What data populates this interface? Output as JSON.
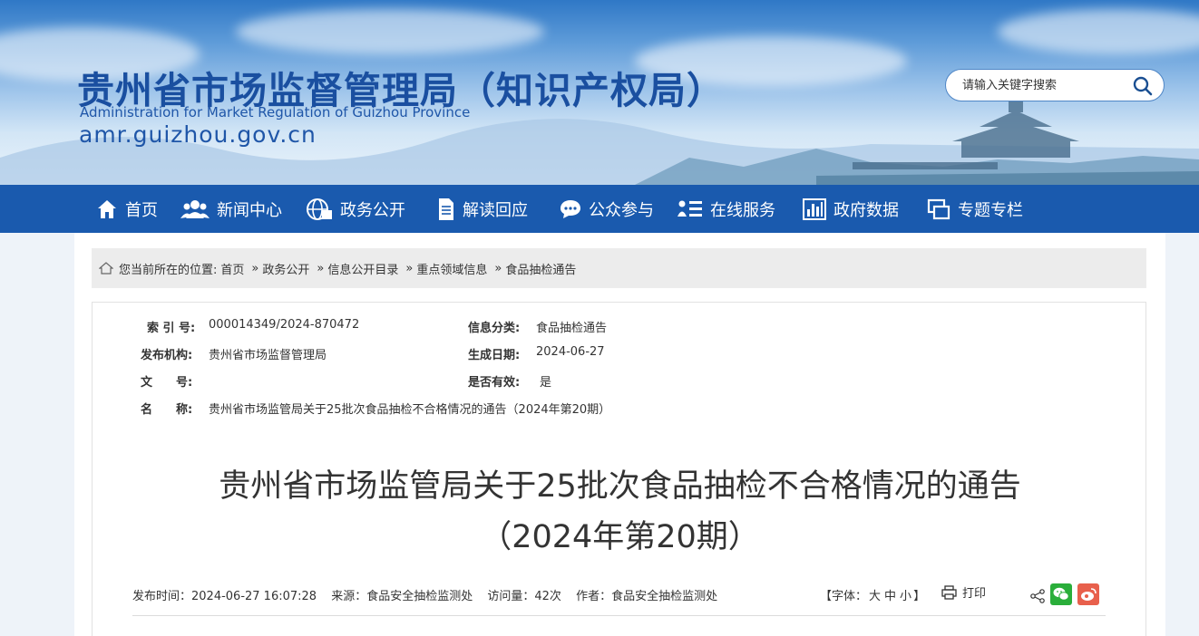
{
  "header": {
    "title": "贵州省市场监督管理局（知识产权局）",
    "subtitle_en": "Administration for Market Regulation of Guizhou Province",
    "url": "amr.guizhou.gov.cn",
    "search_placeholder": "请输入关键字搜索",
    "search_icon": "search-icon"
  },
  "nav": {
    "items": [
      {
        "label": "首页",
        "icon": "home-icon"
      },
      {
        "label": "新闻中心",
        "icon": "users-icon"
      },
      {
        "label": "政务公开",
        "icon": "globe-icon"
      },
      {
        "label": "解读回应",
        "icon": "document-icon"
      },
      {
        "label": "公众参与",
        "icon": "chat-icon"
      },
      {
        "label": "在线服务",
        "icon": "list-icon"
      },
      {
        "label": "政府数据",
        "icon": "bar-chart-icon"
      },
      {
        "label": "专题专栏",
        "icon": "windows-icon"
      }
    ]
  },
  "breadcrumb": {
    "prefix": "您当前所在的位置:",
    "items": [
      "首页",
      "政务公开",
      "信息公开目录",
      "重点领域信息",
      "食品抽检通告"
    ],
    "separator": "»"
  },
  "meta": {
    "index_label": "索 引 号:",
    "index_value": "000014349/2024-870472",
    "category_label": "信息分类:",
    "category_value": "食品抽检通告",
    "publisher_label": "发布机构:",
    "publisher_value": "贵州省市场监督管理局",
    "date_label": "生成日期:",
    "date_value": "2024-06-27",
    "docno_label": "文　　号:",
    "docno_value": "",
    "valid_label": "是否有效:",
    "valid_value": "是",
    "name_label": "名　　称:",
    "name_value": "贵州省市场监管局关于25批次食品抽检不合格情况的通告（2024年第20期）"
  },
  "article": {
    "title_line1": "贵州省市场监管局关于25批次食品抽检不合格情况的通告",
    "title_line2": "（2024年第20期）",
    "publish_time": "发布时间：2024-06-27 16:07:28",
    "source": "来源：食品安全抽检监测处",
    "visits": "访问量：42次",
    "author": "作者：食品安全抽检监测处",
    "font_label_open": "【字体：",
    "font_large": "大",
    "font_medium": "中",
    "font_small": "小",
    "font_label_close": "】",
    "print_label": "打印"
  },
  "colors": {
    "nav_bg": "#1a5aae",
    "title_blue": "#1a4fa0",
    "wechat": "#2aae3a",
    "weibo": "#e8604c"
  }
}
